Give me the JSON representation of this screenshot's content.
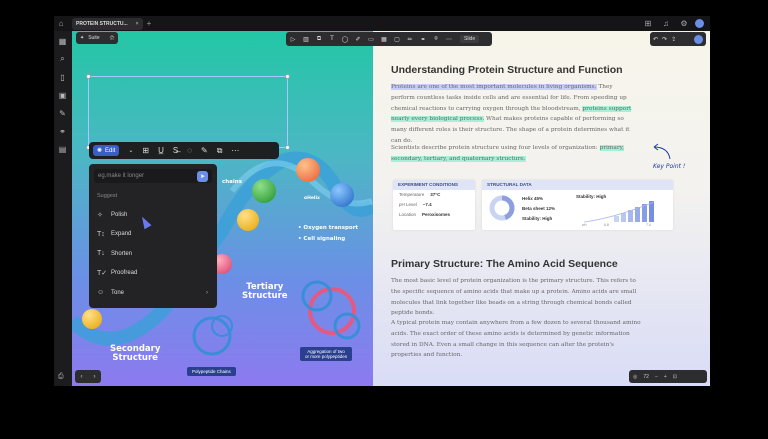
{
  "window": {
    "tab_title": "PROTEIN STRUCTU...",
    "tab_close": "×",
    "new_tab": "+"
  },
  "canvas": {
    "suite_label": "Suite",
    "toolbar_slide_label": "Slide",
    "edit_label": "Edit",
    "ai_input_placeholder": "eg.make it longer",
    "ai_section_label": "Suggest",
    "ai_items": [
      {
        "label": "Polish",
        "icon": "polish-icon"
      },
      {
        "label": "Expand",
        "icon": "expand-icon"
      },
      {
        "label": "Shorten",
        "icon": "shorten-icon"
      },
      {
        "label": "Proofread",
        "icon": "proofread-icon"
      },
      {
        "label": "Tone",
        "icon": "tone-icon"
      }
    ],
    "annotations": {
      "alpha_helix": "αHelix",
      "oxygen": "• Oxygen transport",
      "cell": "• Cell signaling",
      "tertiary": "Tertiary\nStructure",
      "secondary": "Secondary\nStructure",
      "polypeptide": "Polypeptide Chains",
      "aggregation": "Aggregation of two\nor more polypeptides",
      "side_text": "chains"
    },
    "zoom": "72"
  },
  "doc": {
    "title1": "Understanding Protein Structure and Function",
    "p1_a": "Proteins are one of the most important molecules in living organisms.",
    "p1_b": " They perform countless tasks inside cells and are essential for life. From speeding up chemical reactions to carrying oxygen through the bloodstream, ",
    "p1_c": "proteins support nearly every biological process.",
    "p1_d": " What makes proteins capable of performing so many different roles is their structure. The shape of a protein determines what it can do.",
    "p2_a": "Scientists describe protein structure using four levels of organization: ",
    "p2_b": "primary, secondary, tertiary, and quaternary structure.",
    "key_point": "Key Point !",
    "exp_header": "EXPERIMENT CONDITIONS",
    "exp_rows": [
      {
        "label": "Temperature",
        "value": "37°C"
      },
      {
        "label": "pH Level",
        "value": "~7.4"
      },
      {
        "label": "Location",
        "value": "Peroxisomes"
      }
    ],
    "struct_header": "STRUCTURAL DATA",
    "struct_rows": [
      "Helix 45%",
      "Beta sheet 12%",
      "Stability: High"
    ],
    "stability_label": "Stability: High",
    "axis_labels": [
      "pH",
      "6.8",
      "7.4"
    ],
    "title2": "Primary Structure: The Amino Acid Sequence",
    "p3": "The most basic level of protein organization is the primary structure. This refers to the specific sequence of amino acids that make up a protein. Amino acids are small molecules that link together like beads on a string through chemical bonds called peptide bonds.",
    "p4": "A typical protein may contain anywhere from a few dozen to several thousand amino acids. The exact order of these amino acids is determined by genetic information stored in DNA. Even a small change in this sequence can alter the protein's properties and function."
  },
  "colors": {
    "accent": "#3a5ec8",
    "highlight_blue": "#c8cef8",
    "highlight_green": "#a7f0d8"
  }
}
